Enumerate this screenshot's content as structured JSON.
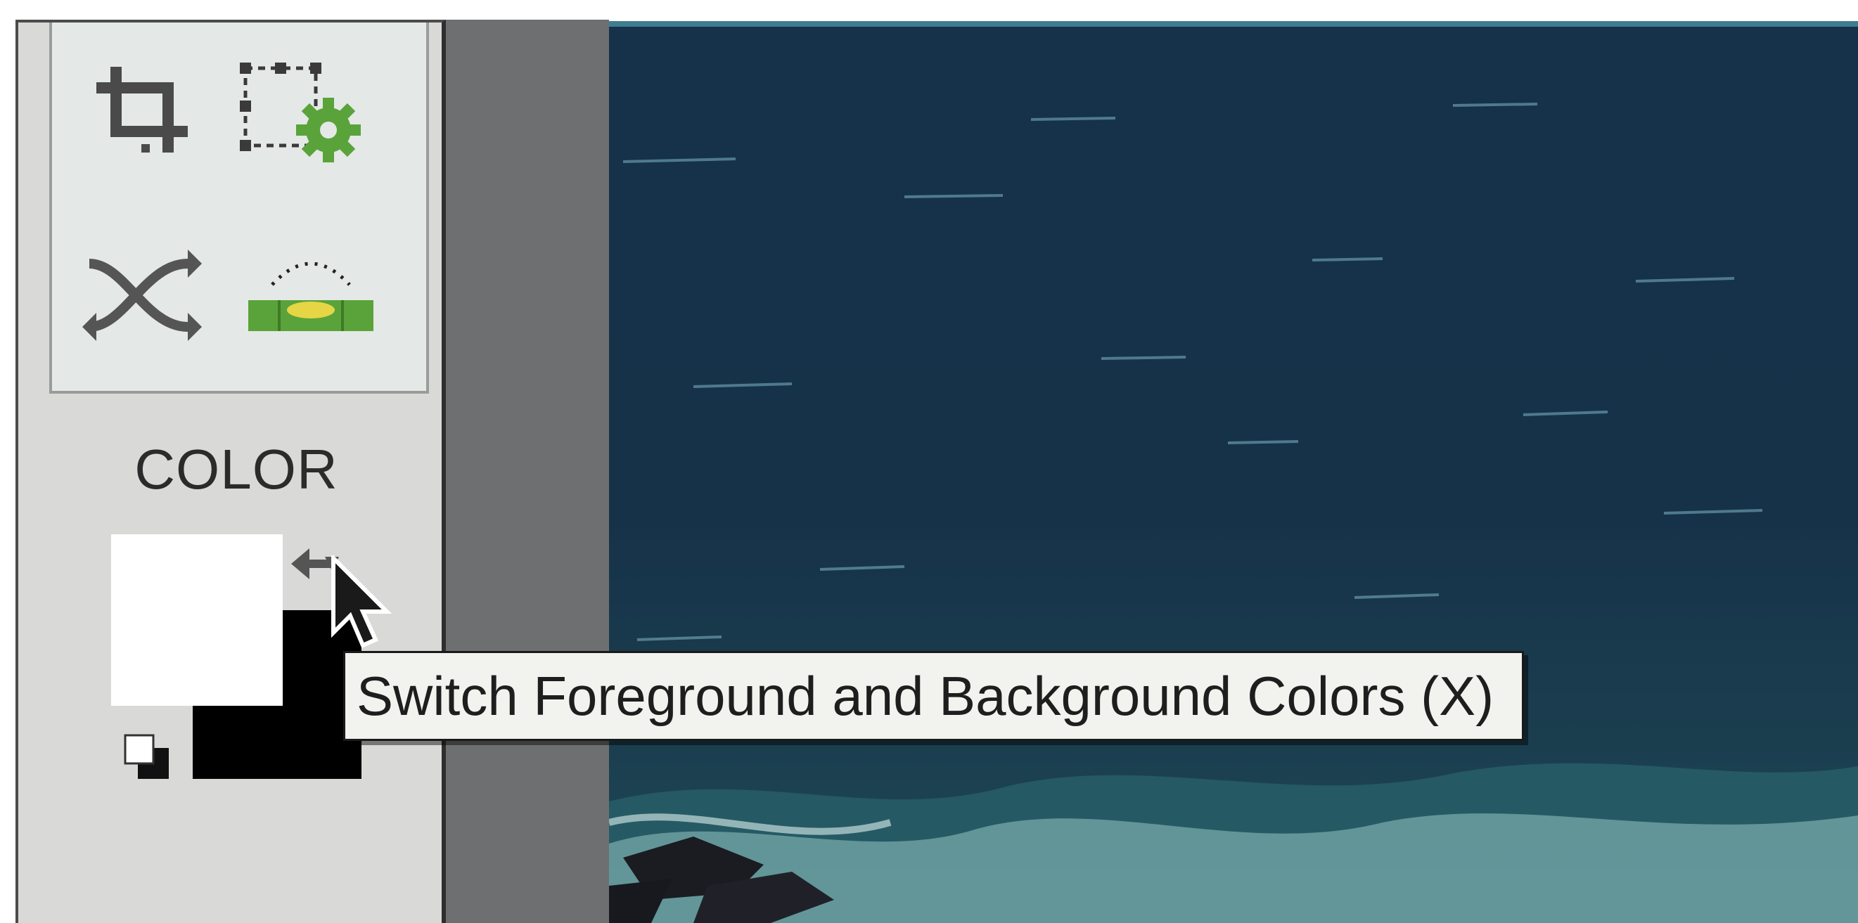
{
  "toolbox": {
    "tools": [
      {
        "icon": "crop-icon"
      },
      {
        "icon": "transform-settings-icon"
      },
      {
        "icon": "shuffle-icon"
      },
      {
        "icon": "straighten-level-icon"
      }
    ],
    "section_heading": "COLOR"
  },
  "colors": {
    "foreground": "#ffffff",
    "background": "#000000",
    "swap_icon": "swap-arrow-icon",
    "default_icon": "default-colors-icon"
  },
  "tooltip": {
    "text": "Switch Foreground and Background Colors (X)"
  },
  "canvas": {
    "content": "ocean-photo"
  },
  "theme": {
    "panel_bg": "#d9dad8",
    "accent_green": "#5aa33a",
    "accent_yellow": "#e6d544"
  }
}
